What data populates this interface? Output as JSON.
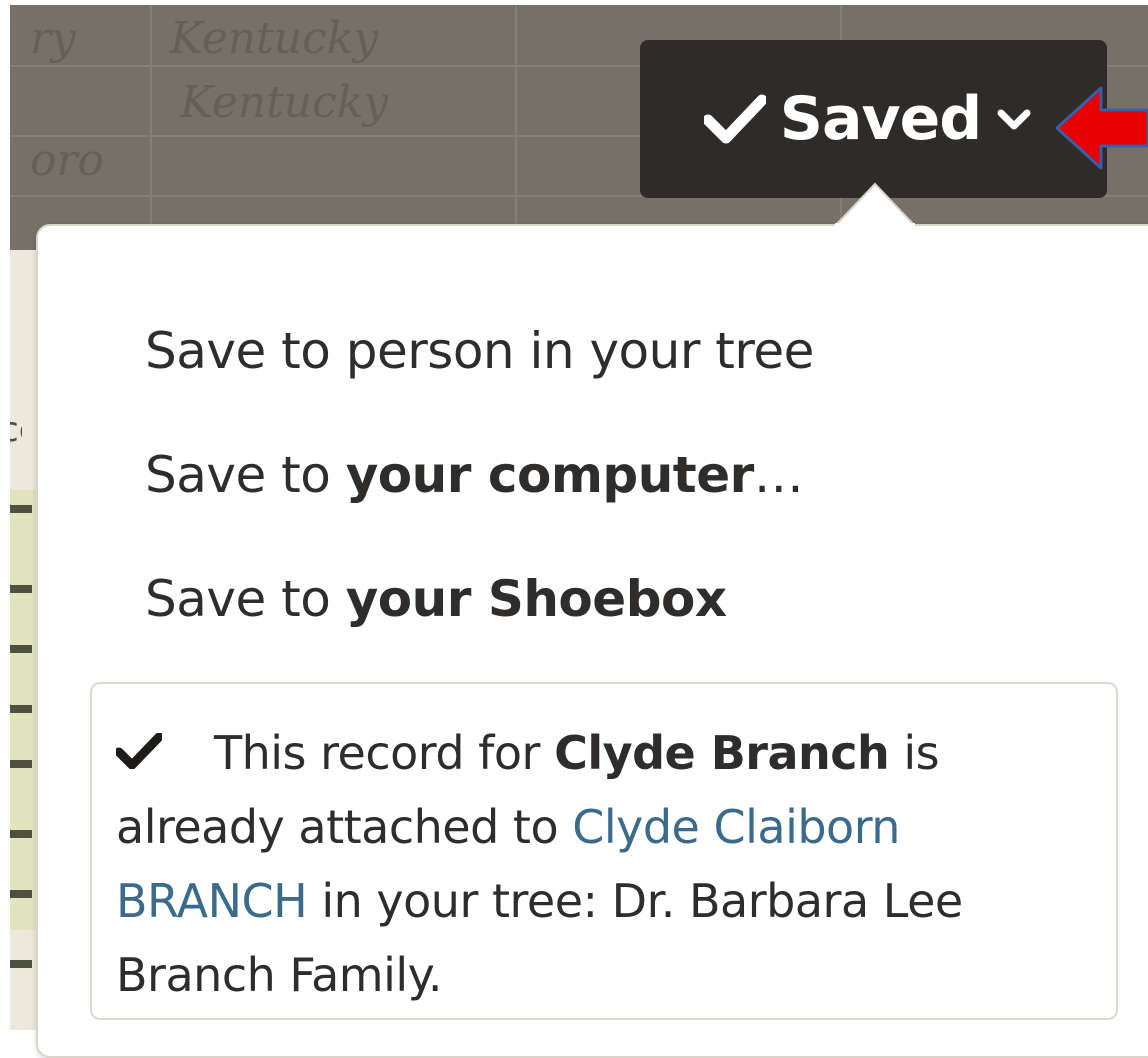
{
  "saved_button": {
    "label": "Saved",
    "check_icon": "checkmark-icon",
    "chevron_icon": "chevron-down-icon"
  },
  "callout_arrow": {
    "color": "#e60000",
    "outline": "#3a5fa8"
  },
  "save_menu": {
    "items": [
      {
        "prefix": "Save to person in your tree",
        "bold": "",
        "suffix": ""
      },
      {
        "prefix": "Save to ",
        "bold": "your computer",
        "suffix": "…"
      },
      {
        "prefix": "Save to ",
        "bold": "your Shoebox",
        "suffix": ""
      }
    ]
  },
  "attached_notice": {
    "icon": "checkmark-icon",
    "text_before": "This record for ",
    "record_name": "Clyde Branch",
    "text_middle": " is already attached to ",
    "person_link": "Clyde Claiborn BRANCH",
    "text_after": " in your tree: Dr. Barbara Lee Branch Family."
  },
  "colors": {
    "button_bg": "#2e2b28",
    "link": "#3a6b8c",
    "text": "#2f2d2b"
  }
}
